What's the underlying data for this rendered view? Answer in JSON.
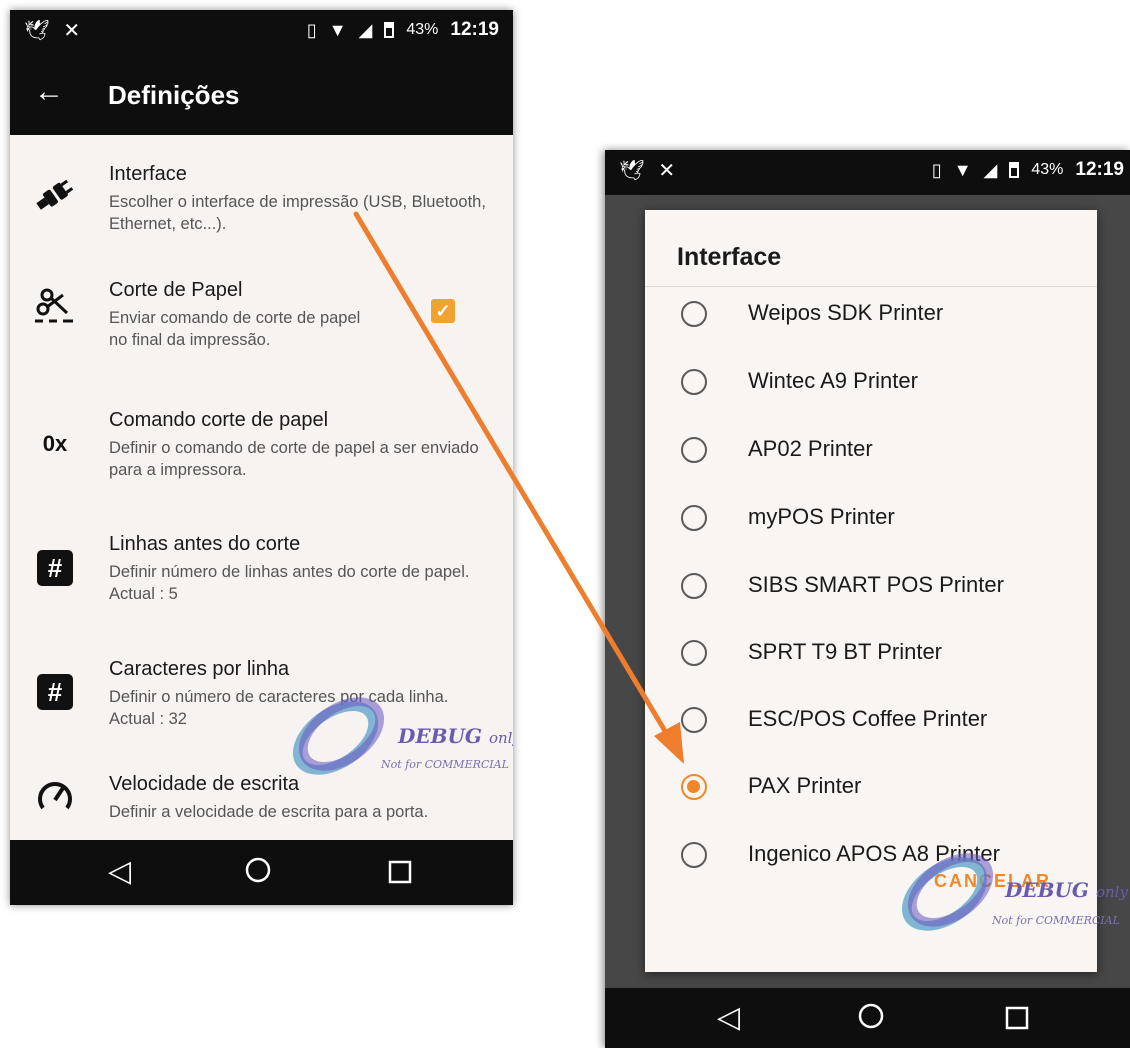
{
  "left_phone": {
    "status": {
      "battery": "43%",
      "time": "12:19"
    },
    "title": "Definições",
    "settings": [
      {
        "icon": "plug-icon",
        "title": "Interface",
        "description": "Escolher o interface de impressão (USB, Bluetooth, Ethernet, etc...)."
      },
      {
        "icon": "paper-cut-icon",
        "title": "Corte de Papel",
        "description": "Enviar comando de corte de papel no final da impressão.",
        "checked": true
      },
      {
        "icon": "hex-code-icon",
        "icon_text": "0x",
        "title": "Comando corte de papel",
        "description": "Definir o comando de corte de papel a ser enviado para a impressora."
      },
      {
        "icon": "hash-icon",
        "icon_text": "#",
        "title": "Linhas antes do corte",
        "description": "Definir número de linhas antes do corte de papel. Actual : 5"
      },
      {
        "icon": "hash-icon",
        "icon_text": "#",
        "title": "Caracteres por linha",
        "description": "Definir o número de caracteres por cada linha. Actual : 32"
      },
      {
        "icon": "speedometer-icon",
        "title": "Velocidade de escrita",
        "description": "Definir a velocidade de escrita para a porta."
      }
    ],
    "watermark": {
      "debug": "DEBUG",
      "only": "only",
      "not_for": "Not for COMMERCIAL"
    }
  },
  "right_phone": {
    "status": {
      "battery": "43%",
      "time": "12:19"
    },
    "dialog": {
      "title": "Interface",
      "options": [
        {
          "label": "Weipos SDK Printer",
          "selected": false
        },
        {
          "label": "Wintec A9 Printer",
          "selected": false
        },
        {
          "label": "AP02 Printer",
          "selected": false
        },
        {
          "label": "myPOS Printer",
          "selected": false
        },
        {
          "label": "SIBS SMART POS Printer",
          "selected": false
        },
        {
          "label": "SPRT T9 BT Printer",
          "selected": false
        },
        {
          "label": "ESC/POS Coffee Printer",
          "selected": false
        },
        {
          "label": "PAX Printer",
          "selected": true
        },
        {
          "label": "Ingenico APOS A8 Printer",
          "selected": false
        }
      ],
      "cancel_label": "CANCELAR"
    },
    "watermark": {
      "debug": "DEBUG",
      "only": "only",
      "not_for": "Not for COMMERCIAL"
    }
  },
  "colors": {
    "accent": "#f0882a",
    "checkbox": "#f0a330",
    "arrow": "#ee7d2e",
    "bar": "#0e0e0e"
  }
}
